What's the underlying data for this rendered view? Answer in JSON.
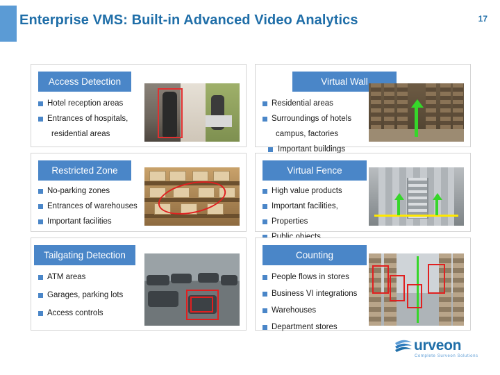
{
  "header": {
    "title": "Enterprise VMS: Built-in Advanced Video Analytics",
    "slide_number": "17"
  },
  "sections": [
    {
      "id": "access-detection",
      "heading": "Access Detection",
      "bullets": [
        "Hotel reception areas",
        "Entrances of hospitals,",
        "residential areas"
      ],
      "thumbnail": "corridor-person-detection-thumbnail"
    },
    {
      "id": "virtual-wall",
      "heading": "Virtual Wall",
      "bullets": [
        "Residential areas",
        "Surroundings of hotels",
        "campus, factories",
        "Important buildings"
      ],
      "thumbnail": "warehouse-aisle-arrow-thumbnail"
    },
    {
      "id": "restricted-zone",
      "heading": "Restricted Zone",
      "bullets": [
        "No-parking zones",
        "Entrances of warehouses",
        "Important facilities"
      ],
      "thumbnail": "shelves-red-ellipse-thumbnail"
    },
    {
      "id": "virtual-fence",
      "heading": "Virtual Fence",
      "bullets": [
        "High value products",
        "Important facilities,",
        "Properties",
        "Public objects"
      ],
      "thumbnail": "elevator-yellow-line-thumbnail"
    },
    {
      "id": "tailgating-detection",
      "heading": "Tailgating Detection",
      "bullets": [
        "ATM areas",
        "Garages, parking lots",
        "Access controls"
      ],
      "thumbnail": "parking-lot-red-box-thumbnail"
    },
    {
      "id": "counting",
      "heading": "Counting",
      "bullets": [
        "People flows in stores",
        "Business VI integrations",
        "Warehouses",
        "Department stores"
      ],
      "thumbnail": "store-aisle-people-counting-thumbnail"
    }
  ],
  "logo": {
    "brand": "urveon",
    "tagline": "Complete Surveon Solutions",
    "accent_color": "#1f6ea8"
  },
  "colors": {
    "accent": "#1f6ea8",
    "pill": "#4a86c8",
    "bar": "#5b9bd5",
    "bullet": "#4a86c8"
  }
}
